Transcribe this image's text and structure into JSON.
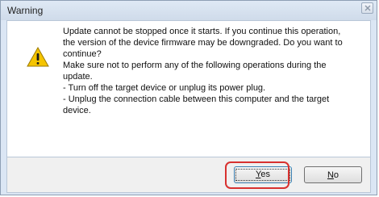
{
  "window": {
    "title": "Warning",
    "close_icon": "close-icon"
  },
  "message": {
    "icon": "warning-icon",
    "lines": [
      "Update cannot be stopped once it starts. If you continue this operation,",
      "the version of the device firmware may be downgraded. Do you want to",
      "continue?",
      "Make sure not to perform any of the following operations during the",
      "update.",
      "- Turn off the target device or unplug its power plug.",
      "- Unplug the connection cable between this computer and the target",
      "device."
    ]
  },
  "buttons": {
    "yes_label": "Yes",
    "yes_mnemonic": "Y",
    "yes_rest": "es",
    "no_label": "No",
    "no_mnemonic": "N",
    "no_rest": "o"
  },
  "colors": {
    "highlight": "#d8312f",
    "warning_yellow": "#f5c400"
  }
}
